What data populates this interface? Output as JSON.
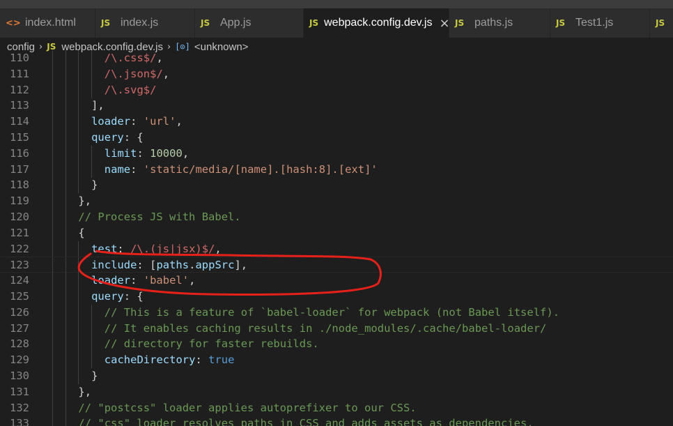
{
  "tabs": [
    {
      "icon": "<>",
      "icon_type": "html",
      "label": "index.html",
      "active": false
    },
    {
      "icon": "JS",
      "icon_type": "js",
      "label": "index.js",
      "active": false
    },
    {
      "icon": "JS",
      "icon_type": "js",
      "label": "App.js",
      "active": false
    },
    {
      "icon": "JS",
      "icon_type": "js",
      "label": "webpack.config.dev.js",
      "active": true,
      "close": "×"
    },
    {
      "icon": "JS",
      "icon_type": "js",
      "label": "paths.js",
      "active": false
    },
    {
      "icon": "JS",
      "icon_type": "js",
      "label": "Test1.js",
      "active": false
    },
    {
      "icon": "JS",
      "icon_type": "js",
      "label": "",
      "active": false
    }
  ],
  "breadcrumb": {
    "folder": "config",
    "file_icon": "JS",
    "file": "webpack.config.dev.js",
    "symbol_icon": "[⊙]",
    "symbol": "<unknown>"
  },
  "lines": [
    {
      "n": "110",
      "indent": 4,
      "tokens": [
        [
          "/\\.css$/",
          "rx"
        ],
        [
          ",",
          "pun"
        ]
      ]
    },
    {
      "n": "111",
      "indent": 4,
      "tokens": [
        [
          "/\\.json$/",
          "rx"
        ],
        [
          ",",
          "pun"
        ]
      ]
    },
    {
      "n": "112",
      "indent": 4,
      "tokens": [
        [
          "/\\.svg$/",
          "rx"
        ]
      ]
    },
    {
      "n": "113",
      "indent": 3,
      "tokens": [
        [
          "],",
          "pun"
        ]
      ]
    },
    {
      "n": "114",
      "indent": 3,
      "tokens": [
        [
          "loader",
          "key"
        ],
        [
          ": ",
          "pun"
        ],
        [
          "'url'",
          "str"
        ],
        [
          ",",
          "pun"
        ]
      ]
    },
    {
      "n": "115",
      "indent": 3,
      "tokens": [
        [
          "query",
          "key"
        ],
        [
          ": {",
          "pun"
        ]
      ]
    },
    {
      "n": "116",
      "indent": 4,
      "tokens": [
        [
          "limit",
          "key"
        ],
        [
          ": ",
          "pun"
        ],
        [
          "10000",
          "num"
        ],
        [
          ",",
          "pun"
        ]
      ]
    },
    {
      "n": "117",
      "indent": 4,
      "tokens": [
        [
          "name",
          "key"
        ],
        [
          ": ",
          "pun"
        ],
        [
          "'static/media/[name].[hash:8].[ext]'",
          "str"
        ]
      ]
    },
    {
      "n": "118",
      "indent": 3,
      "tokens": [
        [
          "}",
          "pun"
        ]
      ]
    },
    {
      "n": "119",
      "indent": 2,
      "tokens": [
        [
          "},",
          "pun"
        ]
      ]
    },
    {
      "n": "120",
      "indent": 2,
      "tokens": [
        [
          "// Process JS with Babel.",
          "cmt"
        ]
      ]
    },
    {
      "n": "121",
      "indent": 2,
      "tokens": [
        [
          "{",
          "pun"
        ]
      ]
    },
    {
      "n": "122",
      "indent": 3,
      "tokens": [
        [
          "test",
          "key"
        ],
        [
          ": ",
          "pun"
        ],
        [
          "/\\.(js|jsx)$/",
          "rx"
        ],
        [
          ",",
          "pun"
        ]
      ]
    },
    {
      "n": "123",
      "indent": 3,
      "tokens": [
        [
          "include",
          "key"
        ],
        [
          ": ",
          "pun"
        ],
        [
          "[",
          "pun"
        ],
        [
          "paths",
          "key"
        ],
        [
          ".",
          "pun"
        ],
        [
          "appSrc",
          "key"
        ],
        [
          "]",
          "pun"
        ],
        [
          ",",
          "pun"
        ]
      ],
      "current": true
    },
    {
      "n": "124",
      "indent": 3,
      "tokens": [
        [
          "loader",
          "key"
        ],
        [
          ": ",
          "pun"
        ],
        [
          "'babel'",
          "str"
        ],
        [
          ",",
          "pun"
        ]
      ]
    },
    {
      "n": "125",
      "indent": 3,
      "tokens": [
        [
          "query",
          "key"
        ],
        [
          ": {",
          "pun"
        ]
      ]
    },
    {
      "n": "126",
      "indent": 4,
      "tokens": [
        [
          "// This is a feature of `babel-loader` for webpack (not Babel itself).",
          "cmt"
        ]
      ]
    },
    {
      "n": "127",
      "indent": 4,
      "tokens": [
        [
          "// It enables caching results in ./node_modules/.cache/babel-loader/",
          "cmt"
        ]
      ]
    },
    {
      "n": "128",
      "indent": 4,
      "tokens": [
        [
          "// directory for faster rebuilds.",
          "cmt"
        ]
      ]
    },
    {
      "n": "129",
      "indent": 4,
      "tokens": [
        [
          "cacheDirectory",
          "key"
        ],
        [
          ": ",
          "pun"
        ],
        [
          "true",
          "kw"
        ]
      ]
    },
    {
      "n": "130",
      "indent": 3,
      "tokens": [
        [
          "}",
          "pun"
        ]
      ]
    },
    {
      "n": "131",
      "indent": 2,
      "tokens": [
        [
          "},",
          "pun"
        ]
      ]
    },
    {
      "n": "132",
      "indent": 2,
      "tokens": [
        [
          "// \"postcss\" loader applies autoprefixer to our CSS.",
          "cmt"
        ]
      ]
    },
    {
      "n": "133",
      "indent": 2,
      "tokens": [
        [
          "// \"css\" loader resolves paths in CSS and adds assets as dependencies.",
          "cmt"
        ]
      ]
    }
  ],
  "colors": {
    "annotation": "#e8201a",
    "active_tab_bg": "#1e1e1e",
    "editor_bg": "#1e1e1e"
  }
}
